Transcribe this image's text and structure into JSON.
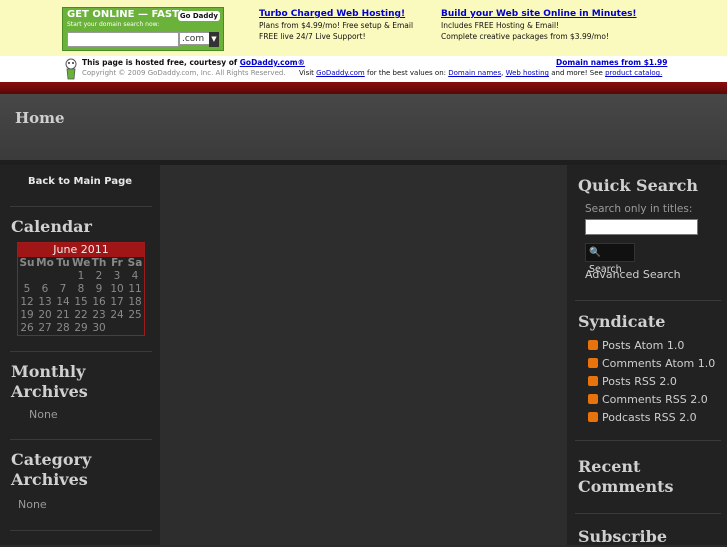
{
  "ad": {
    "godaddy_title": "GET ONLINE — FAST!",
    "godaddy_sub": "Start your domain search now:",
    "godaddy_logo": "Go Daddy",
    "tld": ".com",
    "promo1_title": "Turbo Charged Web Hosting!",
    "promo1_line1": "Plans from $4.99/mo! Free setup & Email",
    "promo1_line2": "FREE live 24/7 Live Support!",
    "promo2_title": "Build your Web site Online in Minutes!",
    "promo2_line1": "Includes FREE Hosting & Email!",
    "promo2_line2": "Complete creative packages from $3.99/mo!",
    "hosted_text": "This page is hosted free, courtesy of",
    "hosted_link": "GoDaddy.com®",
    "copyright": "Copyright © 2009 GoDaddy.com, Inc. All Rights Reserved.",
    "visit_pre": "Visit",
    "visit_link": "GoDaddy.com",
    "visit_mid": "for the best values on:",
    "link_domain_names": "Domain names",
    "link_web_hosting": "Web hosting",
    "visit_and": "and more! See",
    "link_catalog": "product catalog.",
    "domain_promo": "Domain names from $1.99"
  },
  "header": {
    "title": "Home"
  },
  "left": {
    "back_link": "Back to Main Page",
    "calendar_title": "Calendar",
    "calendar_month": "June 2011",
    "weekdays": [
      "Su",
      "Mo",
      "Tu",
      "We",
      "Th",
      "Fr",
      "Sa"
    ],
    "weeks": [
      [
        "",
        "",
        "",
        "1",
        "2",
        "3",
        "4"
      ],
      [
        "5",
        "6",
        "7",
        "8",
        "9",
        "10",
        "11"
      ],
      [
        "12",
        "13",
        "14",
        "15",
        "16",
        "17",
        "18"
      ],
      [
        "19",
        "20",
        "21",
        "22",
        "23",
        "24",
        "25"
      ],
      [
        "26",
        "27",
        "28",
        "29",
        "30",
        "",
        ""
      ]
    ],
    "monthly_title_1": "Monthly",
    "monthly_title_2": "Archives",
    "monthly_none": "None",
    "category_title_1": "Category",
    "category_title_2": "Archives",
    "category_none": "None"
  },
  "right": {
    "quick_search_title": "Quick Search",
    "search_label": "Search only in titles:",
    "search_button": "Search",
    "advanced_search": "Advanced Search",
    "syndicate_title": "Syndicate",
    "feeds": [
      "Posts Atom 1.0",
      "Comments Atom 1.0",
      "Posts RSS 2.0",
      "Comments RSS 2.0",
      "Podcasts RSS 2.0"
    ],
    "recent_comments_1": "Recent",
    "recent_comments_2": "Comments",
    "subscribe_title": "Subscribe"
  },
  "colors": {
    "red_bar": "#8a0c0c",
    "calendar_accent": "#a01515",
    "rss": "#e8720c",
    "link": "#0000cc"
  }
}
